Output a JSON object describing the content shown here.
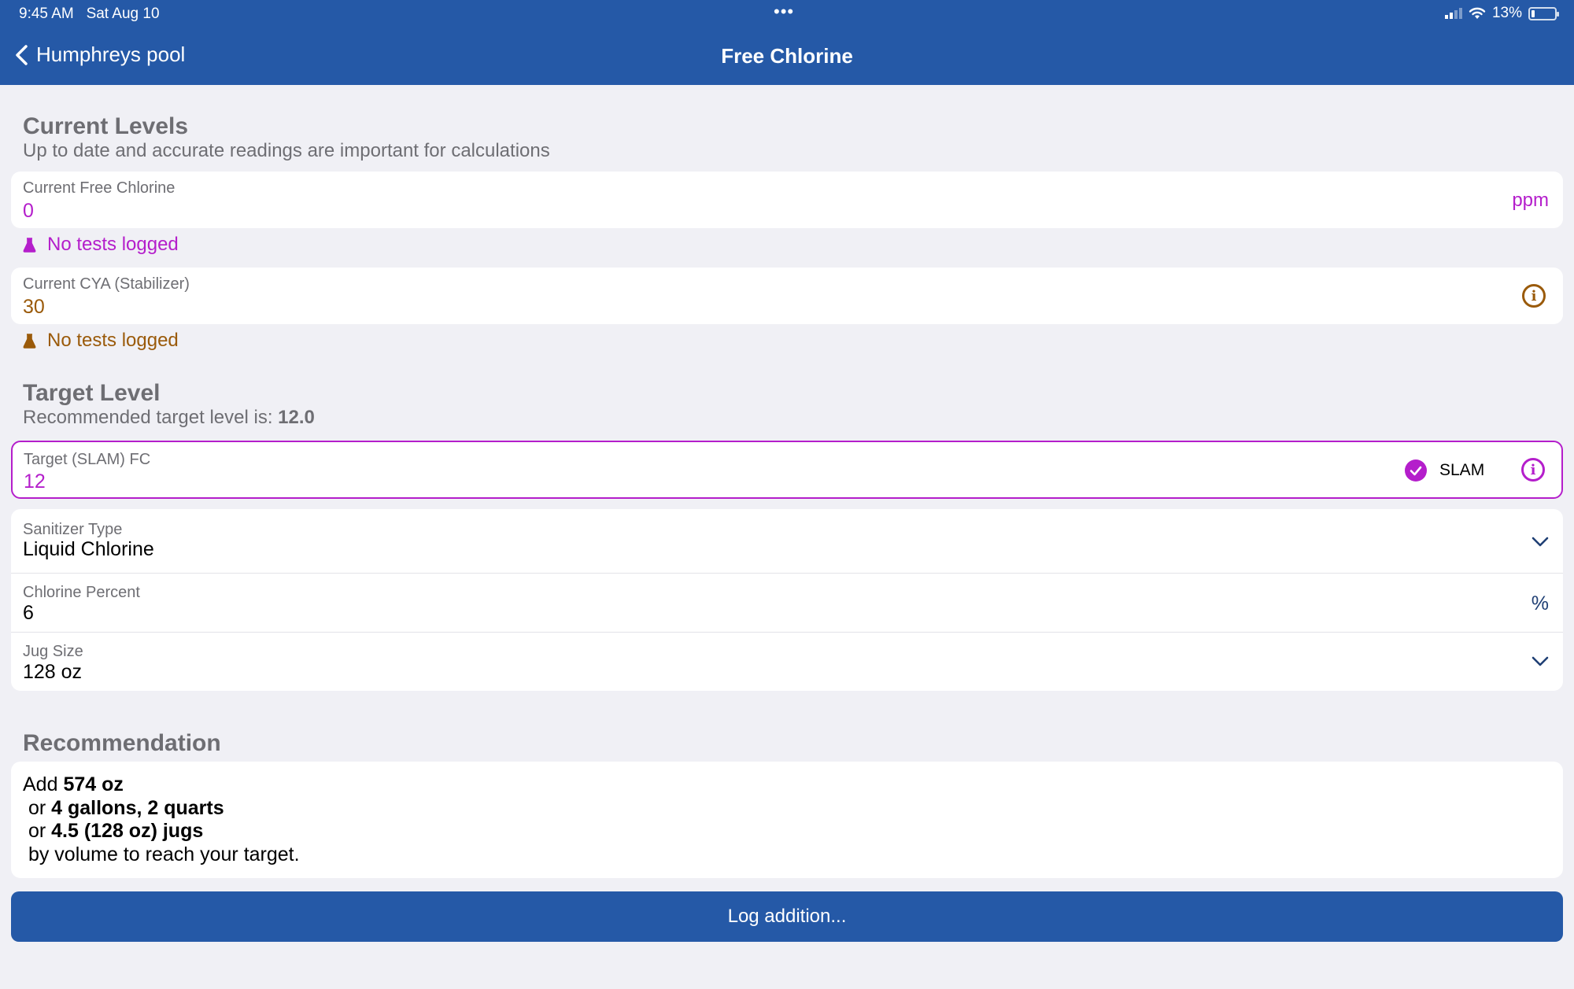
{
  "status_bar": {
    "time": "9:45 AM",
    "date": "Sat Aug 10",
    "battery": "13%"
  },
  "nav": {
    "back_label": "Humphreys pool",
    "title": "Free Chlorine"
  },
  "current_levels": {
    "heading": "Current Levels",
    "subtitle": "Up to date and accurate readings are important for calculations",
    "fc_label": "Current Free Chlorine",
    "fc_value": "0",
    "fc_unit": "ppm",
    "fc_note": "No tests logged",
    "cya_label": "Current CYA (Stabilizer)",
    "cya_value": "30",
    "cya_note": "No tests logged"
  },
  "target_level": {
    "heading": "Target Level",
    "subtitle_prefix": "Recommended target level is: ",
    "recommended": "12.0",
    "target_label": "Target (SLAM) FC",
    "target_value": "12",
    "slam_label": "SLAM",
    "slam_checked": true
  },
  "settings": {
    "sanitizer_label": "Sanitizer Type",
    "sanitizer_value": "Liquid Chlorine",
    "percent_label": "Chlorine Percent",
    "percent_value": "6",
    "percent_unit": "%",
    "jug_label": "Jug Size",
    "jug_value": "128 oz"
  },
  "recommendation": {
    "heading": "Recommendation",
    "add_prefix": "Add ",
    "add_amount": "574 oz",
    "or_prefix": " or ",
    "alt1": "4 gallons, 2 quarts",
    "alt2": "4.5 (128 oz) jugs",
    "suffix": " by volume to reach your target."
  },
  "log_button": "Log addition...",
  "colors": {
    "header": "#2559a7",
    "accent_purple": "#b41ecb",
    "accent_brown": "#9a5a0a",
    "background": "#f0f0f5"
  }
}
